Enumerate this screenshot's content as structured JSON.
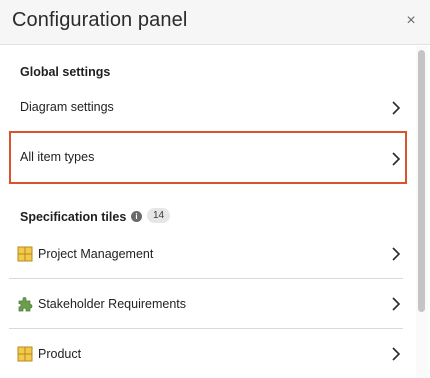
{
  "panel": {
    "title": "Configuration panel",
    "close_glyph": "×"
  },
  "global_settings": {
    "title": "Global settings",
    "items": [
      {
        "label": "Diagram settings",
        "icon": "chevron-right-icon"
      },
      {
        "label": "All item types",
        "icon": "chevron-right-icon",
        "selected": true
      }
    ]
  },
  "specification_tiles": {
    "title": "Specification tiles",
    "count": "14",
    "info_glyph": "i",
    "items": [
      {
        "label": "Project Management",
        "icon": "grid-tile-icon"
      },
      {
        "label": "Stakeholder Requirements",
        "icon": "puzzle-icon"
      },
      {
        "label": "Product",
        "icon": "grid-tile-icon"
      }
    ]
  },
  "colors": {
    "selected_border": "#d9542c",
    "tile_yellow": "#f2c94c",
    "tile_border": "#b88a1d",
    "puzzle_green": "#6a9e4b"
  }
}
